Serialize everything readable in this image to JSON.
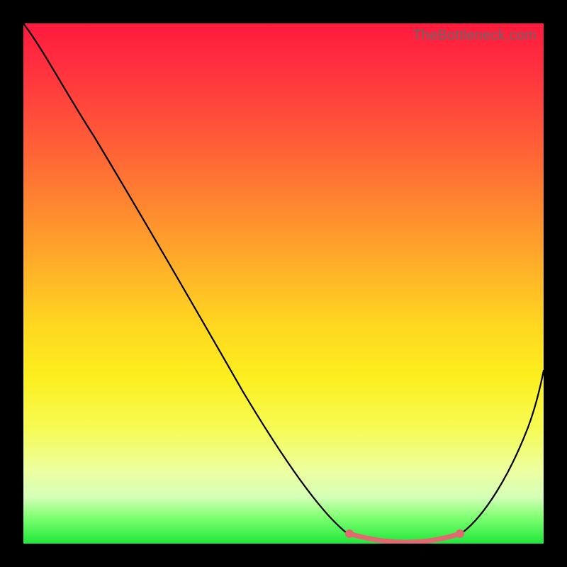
{
  "watermark": "TheBottleneck.com",
  "colors": {
    "frame": "#000000",
    "curve": "#000000",
    "highlight": "#e06a6f",
    "gradient_top": "#ff1a3d",
    "gradient_bottom": "#1fe83a"
  },
  "chart_data": {
    "type": "line",
    "title": "",
    "xlabel": "",
    "ylabel": "",
    "xlim": [
      0,
      100
    ],
    "ylim": [
      0,
      100
    ],
    "x": [
      0,
      5,
      10,
      15,
      20,
      25,
      30,
      35,
      40,
      45,
      50,
      55,
      60,
      63,
      66,
      70,
      74,
      78,
      82,
      86,
      90,
      94,
      98,
      100
    ],
    "values": [
      100,
      97,
      92,
      85,
      77,
      69,
      61,
      53,
      45,
      36,
      27,
      18,
      10,
      5,
      2,
      0.5,
      0,
      0,
      0.5,
      2,
      8,
      18,
      30,
      37
    ],
    "note": "y = 100 at top (far from optimum), y = 0 at bottom (optimum). Curve descends steeply, flat minimum around x≈70–80, then rises.",
    "highlight_region": {
      "x_start": 62,
      "x_end": 85,
      "y_approx": 0
    }
  }
}
